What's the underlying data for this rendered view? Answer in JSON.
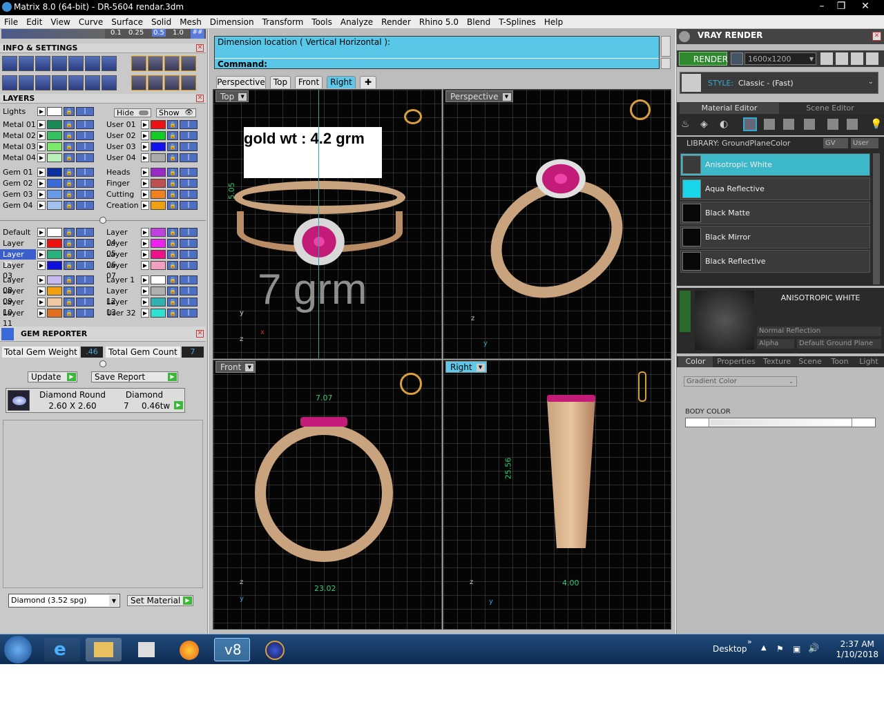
{
  "window": {
    "title": "Matrix 8.0 (64-bit) - DR-5604 rendar.3dm"
  },
  "menu": [
    "File",
    "Edit",
    "View",
    "Curve",
    "Surface",
    "Solid",
    "Mesh",
    "Dimension",
    "Transform",
    "Tools",
    "Analyze",
    "Render",
    "Rhino 5.0",
    "Blend",
    "T-Splines",
    "Help"
  ],
  "snap_values": [
    "0.1",
    "0.25",
    "0.5",
    "1.0"
  ],
  "info_panel": {
    "title": "INFO & SETTINGS"
  },
  "layers": {
    "title": "LAYERS",
    "hide_label": "Hide",
    "show_label": "Show",
    "left_col": [
      {
        "name": "Lights",
        "color": "#ffffff"
      },
      {
        "name": "Metal 01",
        "color": "#1a8a5a"
      },
      {
        "name": "Metal 02",
        "color": "#35c060"
      },
      {
        "name": "Metal 03",
        "color": "#7bea6a"
      },
      {
        "name": "Metal 04",
        "color": "#b8f0b8"
      },
      {
        "name": "Gem 01",
        "color": "#0a2fa0"
      },
      {
        "name": "Gem 02",
        "color": "#3a6ad8"
      },
      {
        "name": "Gem 03",
        "color": "#6a9ae8"
      },
      {
        "name": "Gem 04",
        "color": "#a0c0f0"
      },
      {
        "name": "Default",
        "color": "#ffffff"
      },
      {
        "name": "Layer 01",
        "color": "#ee1111"
      },
      {
        "name": "Layer 02",
        "color": "#2ab07a"
      },
      {
        "name": "Layer 03",
        "color": "#1010dd"
      },
      {
        "name": "Layer 08",
        "color": "#c8b8f0"
      },
      {
        "name": "Layer 09",
        "color": "#f0a010"
      },
      {
        "name": "Layer 10",
        "color": "#f0c8a0"
      },
      {
        "name": "Layer 11",
        "color": "#e07020"
      }
    ],
    "right_col": [
      {
        "name": "User 01",
        "color": "#ee1111"
      },
      {
        "name": "User 02",
        "color": "#11cc22"
      },
      {
        "name": "User 03",
        "color": "#1111ee"
      },
      {
        "name": "User 04",
        "color": "#aaaaaa"
      },
      {
        "name": "Heads",
        "color": "#9a2ac8"
      },
      {
        "name": "Finger",
        "color": "#c05050"
      },
      {
        "name": "Cutting",
        "color": "#f08020"
      },
      {
        "name": "Creation",
        "color": "#f0a010"
      },
      {
        "name": "Layer 04",
        "color": "#c040e0"
      },
      {
        "name": "Layer 05",
        "color": "#ee22ee"
      },
      {
        "name": "Layer 06",
        "color": "#ee1188"
      },
      {
        "name": "Layer 07",
        "color": "#f0a0c0"
      },
      {
        "name": "Layer 1",
        "color": "#ffffff"
      },
      {
        "name": "Layer 12",
        "color": "#b0b0b0"
      },
      {
        "name": "Layer 13",
        "color": "#30b0b0"
      },
      {
        "name": "User 32",
        "color": "#30e0d0"
      }
    ]
  },
  "gem_reporter": {
    "title": "GEM REPORTER",
    "total_weight_label": "Total Gem Weight",
    "total_weight": ".46",
    "total_count_label": "Total Gem Count",
    "total_count": "7",
    "update_label": "Update",
    "save_label": "Save Report",
    "row": {
      "cut": "Diamond Round",
      "material": "Diamond",
      "size": "2.60 X 2.60",
      "count": "7",
      "weight": "0.46tw"
    },
    "material_select": "Diamond     (3.52 spg)",
    "set_material_label": "Set Material"
  },
  "command": {
    "line1": "Dimension location ( Vertical  Horizontal ):",
    "line2": "Command:"
  },
  "view_tabs": [
    "Perspective",
    "Top",
    "Front",
    "Right"
  ],
  "viewports": {
    "top": {
      "label": "Top",
      "overlay_text": "gold wt : 4.2 grm",
      "watermark": "7 grm",
      "dim": "5.05"
    },
    "perspective": {
      "label": "Perspective"
    },
    "front": {
      "label": "Front",
      "dim_top": "7.07",
      "dim_bottom": "23.02"
    },
    "right": {
      "label": "Right",
      "dim_side": "25.56",
      "dim_bottom": "4.00"
    }
  },
  "vray": {
    "title": "VRAY RENDER",
    "render_label": "RENDER",
    "resolution": "1600x1200",
    "style_label": "STYLE:",
    "style_value": "Classic - (Fast)",
    "tabs": [
      "Material Editor",
      "Scene Editor"
    ],
    "library_label": "LIBRARY: GroundPlaneColor",
    "gv_label": "GV",
    "user_label": "User",
    "materials": [
      {
        "name": "Anisotropic White",
        "color": "#3a3a3a"
      },
      {
        "name": "Aqua Reflective",
        "color": "#1ad4e8"
      },
      {
        "name": "Black Matte",
        "color": "#080808"
      },
      {
        "name": "Black Mirror",
        "color": "#080808"
      },
      {
        "name": "Black Reflective",
        "color": "#080808"
      }
    ],
    "selected_title": "ANISOTROPIC WHITE",
    "reflection_mode": "Normal Reflection",
    "alpha_label": "Alpha",
    "ground_plane": "Default Ground Plane",
    "prop_tabs": [
      "Color",
      "Properties",
      "Texture",
      "Scene",
      "Toon",
      "Light"
    ],
    "color_mode": "Gradient Color",
    "body_color_label": "BODY COLOR"
  },
  "taskbar": {
    "desktop_label": "Desktop",
    "time": "2:37 AM",
    "date": "1/10/2018"
  }
}
